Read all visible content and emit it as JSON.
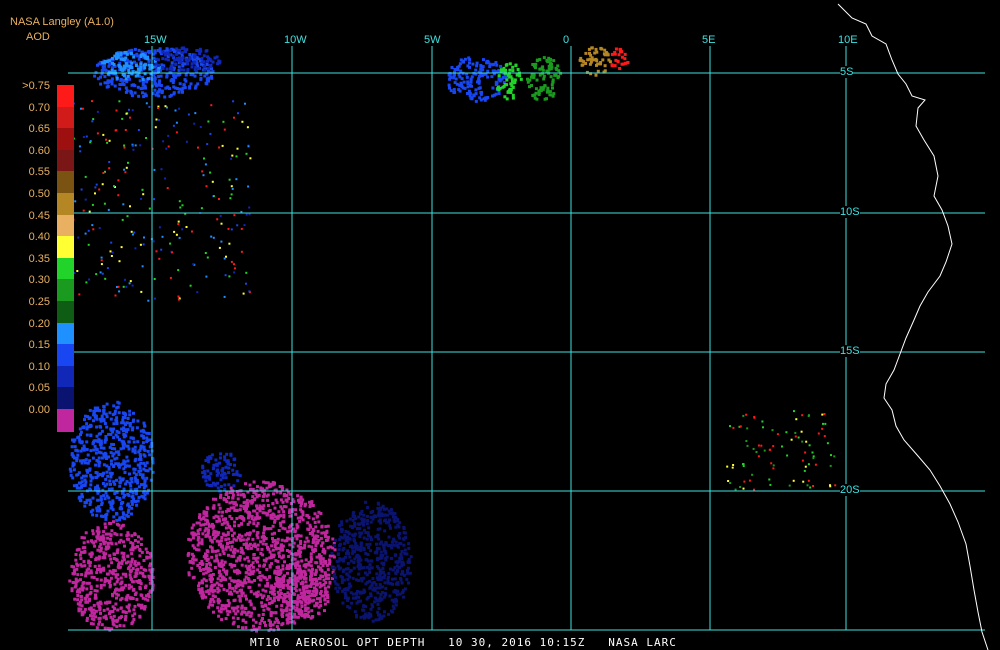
{
  "header": {
    "source": "NASA Langley (A1.0)",
    "parameter": "AOD"
  },
  "legend": {
    "entries": [
      {
        "label": ">0.75",
        "color": "#ff1a1a"
      },
      {
        "label": "0.70",
        "color": "#d11a1a"
      },
      {
        "label": "0.65",
        "color": "#9e1010"
      },
      {
        "label": "0.60",
        "color": "#7a1616"
      },
      {
        "label": "0.55",
        "color": "#7a5212"
      },
      {
        "label": "0.50",
        "color": "#b58624"
      },
      {
        "label": "0.45",
        "color": "#e8b060"
      },
      {
        "label": "0.40",
        "color": "#ffff33"
      },
      {
        "label": "0.35",
        "color": "#22d42a"
      },
      {
        "label": "0.30",
        "color": "#1a9a1e"
      },
      {
        "label": "0.25",
        "color": "#0f5c14"
      },
      {
        "label": "0.20",
        "color": "#1e90ff"
      },
      {
        "label": "0.15",
        "color": "#1846f0"
      },
      {
        "label": "0.10",
        "color": "#1027b8"
      },
      {
        "label": "0.05",
        "color": "#0a1470"
      },
      {
        "label": "0.00",
        "color": "#c0269e"
      }
    ]
  },
  "grid": {
    "color": "#40e0e0",
    "lon_labels": [
      "15W",
      "10W",
      "5W",
      "0",
      "5E",
      "10E"
    ],
    "lat_labels": [
      "5S",
      "10S",
      "15S",
      "20S"
    ]
  },
  "footer": {
    "text": "MT10  AEROSOL OPT DEPTH   10 30, 2016 10:15Z   NASA LARC"
  }
}
